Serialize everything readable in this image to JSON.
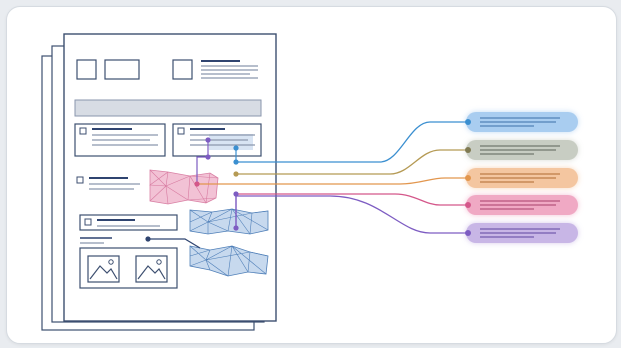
{
  "colors": {
    "page_border": "#3d4f70",
    "line_dark": "#2f4470",
    "line_mid": "#8a96ad",
    "header_bar": "#d7dce4",
    "region_pink": "#f2bfd3",
    "region_blue": "#c7d9ee",
    "tags": [
      "#a9cdf0",
      "#c8cdc3",
      "#f4c6a0",
      "#f0a9c4",
      "#c8b6e6"
    ],
    "connectors": [
      "#3b8fd0",
      "#b59a54",
      "#e2964e",
      "#d4578a",
      "#7d5cc2"
    ]
  },
  "icons": {
    "document": "document-stack-icon",
    "image_placeholder": "image-placeholder-icon",
    "checkbox": "checkbox-icon"
  },
  "diagram": {
    "tag_count": 5,
    "style": "document layout regions linked to annotation tags"
  }
}
